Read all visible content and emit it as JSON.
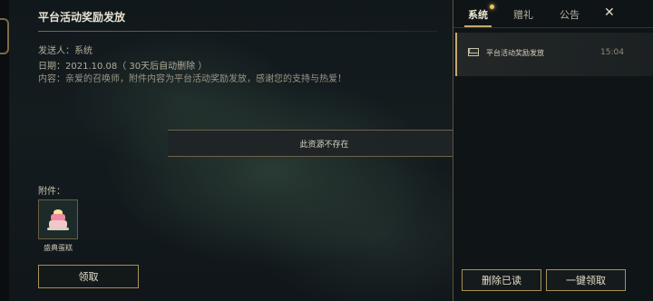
{
  "mail": {
    "title": "平台活动奖励发放",
    "sender": "发送人：系统",
    "date": "日期：2021.10.08（ 30天后自动删除 ）",
    "content": "内容：亲爱的召唤师，附件内容为平台活动奖励发放，感谢您的支持与热爱！"
  },
  "toast": {
    "message": "此资源不存在"
  },
  "attachments": {
    "label": "附件：",
    "items": [
      {
        "name": "盛典蛋糕",
        "icon": "cake-icon"
      }
    ]
  },
  "actions": {
    "claim_label": "领取"
  },
  "panel": {
    "tabs": [
      {
        "label": "系统",
        "active": true
      },
      {
        "label": "赠礼",
        "active": false
      },
      {
        "label": "公告",
        "active": false
      }
    ],
    "close_symbol": "✕",
    "mail_list": [
      {
        "title": "平台活动奖励发放",
        "time": "15:04",
        "icon": "mail-icon"
      }
    ],
    "delete_read_label": "删除已读",
    "claim_all_label": "一键领取"
  },
  "colors": {
    "accent": "#c8aa6e",
    "panel_bg": "#0f1417",
    "notify_dot": "#e8c45a"
  }
}
